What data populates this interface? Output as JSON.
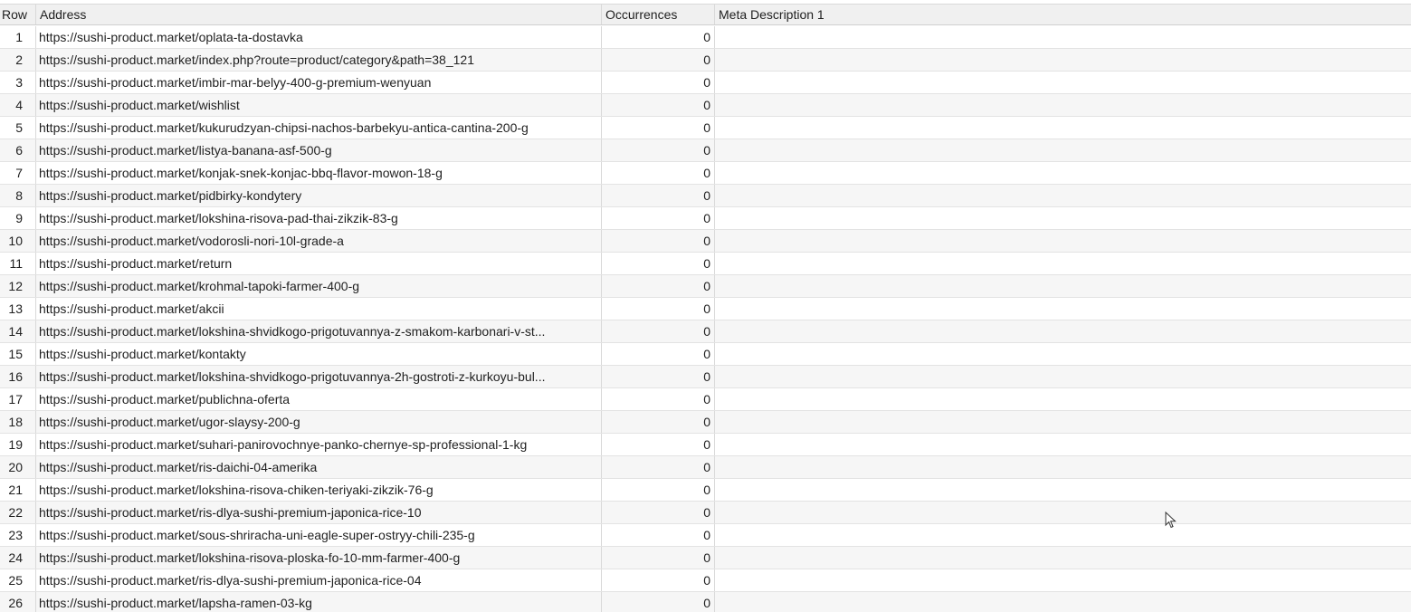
{
  "table": {
    "columns": {
      "row": "Row",
      "address": "Address",
      "occurrences": "Occurrences",
      "meta": "Meta Description 1"
    },
    "rows": [
      {
        "row": "1",
        "address": "https://sushi-product.market/oplata-ta-dostavka",
        "occurrences": "0",
        "meta": ""
      },
      {
        "row": "2",
        "address": "https://sushi-product.market/index.php?route=product/category&path=38_121",
        "occurrences": "0",
        "meta": ""
      },
      {
        "row": "3",
        "address": "https://sushi-product.market/imbir-mar-belyy-400-g-premium-wenyuan",
        "occurrences": "0",
        "meta": ""
      },
      {
        "row": "4",
        "address": "https://sushi-product.market/wishlist",
        "occurrences": "0",
        "meta": ""
      },
      {
        "row": "5",
        "address": "https://sushi-product.market/kukurudzyan-chipsi-nachos-barbekyu-antica-cantina-200-g",
        "occurrences": "0",
        "meta": ""
      },
      {
        "row": "6",
        "address": "https://sushi-product.market/listya-banana-asf-500-g",
        "occurrences": "0",
        "meta": ""
      },
      {
        "row": "7",
        "address": "https://sushi-product.market/konjak-snek-konjac-bbq-flavor-mowon-18-g",
        "occurrences": "0",
        "meta": ""
      },
      {
        "row": "8",
        "address": "https://sushi-product.market/pidbirky-kondytery",
        "occurrences": "0",
        "meta": ""
      },
      {
        "row": "9",
        "address": "https://sushi-product.market/lokshina-risova-pad-thai-zikzik-83-g",
        "occurrences": "0",
        "meta": ""
      },
      {
        "row": "10",
        "address": "https://sushi-product.market/vodorosli-nori-10l-grade-a",
        "occurrences": "0",
        "meta": ""
      },
      {
        "row": "11",
        "address": "https://sushi-product.market/return",
        "occurrences": "0",
        "meta": ""
      },
      {
        "row": "12",
        "address": "https://sushi-product.market/krohmal-tapoki-farmer-400-g",
        "occurrences": "0",
        "meta": ""
      },
      {
        "row": "13",
        "address": "https://sushi-product.market/akcii",
        "occurrences": "0",
        "meta": ""
      },
      {
        "row": "14",
        "address": "https://sushi-product.market/lokshina-shvidkogo-prigotuvannya-z-smakom-karbonari-v-st...",
        "occurrences": "0",
        "meta": ""
      },
      {
        "row": "15",
        "address": "https://sushi-product.market/kontakty",
        "occurrences": "0",
        "meta": ""
      },
      {
        "row": "16",
        "address": "https://sushi-product.market/lokshina-shvidkogo-prigotuvannya-2h-gostroti-z-kurkoyu-bul...",
        "occurrences": "0",
        "meta": ""
      },
      {
        "row": "17",
        "address": "https://sushi-product.market/publichna-oferta",
        "occurrences": "0",
        "meta": ""
      },
      {
        "row": "18",
        "address": "https://sushi-product.market/ugor-slaysy-200-g",
        "occurrences": "0",
        "meta": ""
      },
      {
        "row": "19",
        "address": "https://sushi-product.market/suhari-panirovochnye-panko-chernye-sp-professional-1-kg",
        "occurrences": "0",
        "meta": ""
      },
      {
        "row": "20",
        "address": "https://sushi-product.market/ris-daichi-04-amerika",
        "occurrences": "0",
        "meta": ""
      },
      {
        "row": "21",
        "address": "https://sushi-product.market/lokshina-risova-chiken-teriyaki-zikzik-76-g",
        "occurrences": "0",
        "meta": ""
      },
      {
        "row": "22",
        "address": "https://sushi-product.market/ris-dlya-sushi-premium-japonica-rice-10",
        "occurrences": "0",
        "meta": ""
      },
      {
        "row": "23",
        "address": "https://sushi-product.market/sous-shriracha-uni-eagle-super-ostryy-chili-235-g",
        "occurrences": "0",
        "meta": ""
      },
      {
        "row": "24",
        "address": "https://sushi-product.market/lokshina-risova-ploska-fo-10-mm-farmer-400-g",
        "occurrences": "0",
        "meta": ""
      },
      {
        "row": "25",
        "address": "https://sushi-product.market/ris-dlya-sushi-premium-japonica-rice-04",
        "occurrences": "0",
        "meta": ""
      },
      {
        "row": "26",
        "address": "https://sushi-product.market/lapsha-ramen-03-kg",
        "occurrences": "0",
        "meta": ""
      }
    ]
  },
  "cursor": {
    "icon": "mouse-pointer-icon"
  }
}
